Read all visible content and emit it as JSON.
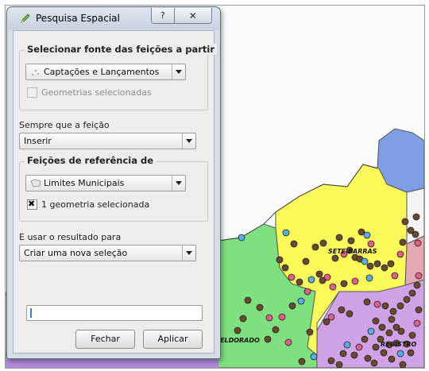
{
  "window": {
    "title": "Pesquisa Espacial",
    "help_glyph": "?",
    "close_glyph": "✕"
  },
  "source_group": {
    "title": "Selecionar fonte das feições a partir",
    "layer_combo": "Captações e Lançamentos",
    "selected_only_label": "Geometrias selecionadas",
    "selected_only_checked": false
  },
  "when_feature": {
    "label": "Sempre que a feição",
    "combo": "Inserir"
  },
  "reference_group": {
    "title": "Feições de referência de",
    "layer_combo": "Limites Municipais",
    "selected_label": "1 geometria selecionada",
    "selected_checked": true
  },
  "use_result": {
    "label": "E usar o resultado para",
    "combo": "Criar uma nova seleção"
  },
  "buttons": {
    "close": "Fechar",
    "apply": "Aplicar"
  },
  "map": {
    "labels": [
      "SETE BARRAS",
      "ELDORADO",
      "REGISTRO"
    ],
    "colors": {
      "yellow_region": "#fafa5a",
      "green_region": "#7ee07e",
      "blue_region": "#7f9ee6",
      "pink_region": "#e5a9b4",
      "lilac_region": "#cfa3e6",
      "brown_points": "#6a4a2f",
      "blue_points": "#5aaee8",
      "pink_points": "#e0608a"
    }
  },
  "icons": {
    "window_icon": "pencil-icon",
    "points_layer_icon": "point-layer-icon",
    "polygon_layer_icon": "polygon-layer-icon"
  }
}
